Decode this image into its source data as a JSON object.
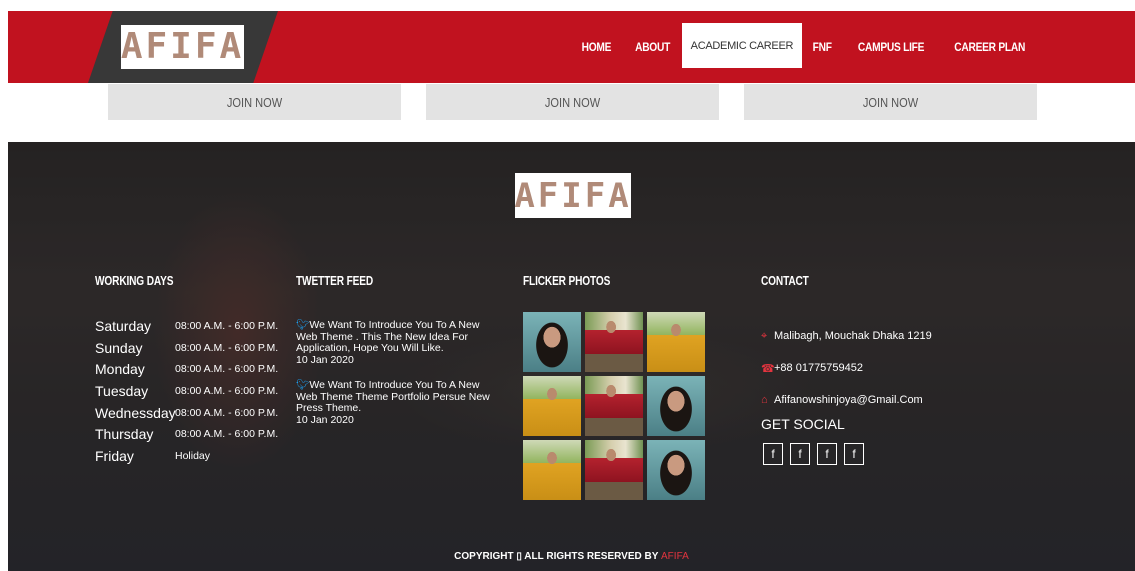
{
  "header": {
    "logo": "AFIFA",
    "nav": [
      {
        "label": "HOME",
        "active": false
      },
      {
        "label": "ABOUT",
        "active": false
      },
      {
        "label": "ACADEMIC CAREER",
        "active": true
      },
      {
        "label": "FNF",
        "active": false
      },
      {
        "label": "CAMPUS LIFE",
        "active": false
      },
      {
        "label": "CAREER PLAN",
        "active": false
      }
    ],
    "colors": {
      "brand_red": "#c1121f",
      "dark": "#383838",
      "logo_text": "#b08a78"
    }
  },
  "join_buttons": [
    "JOIN NOW",
    "JOIN NOW",
    "JOIN NOW"
  ],
  "footer": {
    "logo": "AFIFA",
    "working_days": {
      "title": "WORKING DAYS",
      "rows": [
        {
          "day": "Saturday",
          "time": "08:00 A.M. - 6:00 P.M."
        },
        {
          "day": "Sunday",
          "time": "08:00 A.M. - 6:00 P.M."
        },
        {
          "day": "Monday",
          "time": "08:00 A.M. - 6:00 P.M."
        },
        {
          "day": "Tuesday",
          "time": "08:00 A.M. - 6:00 P.M."
        },
        {
          "day": "Wednessday",
          "time": "08:00 A.M. - 6:00 P.M."
        },
        {
          "day": "Thursday",
          "time": "08:00 A.M. - 6:00 P.M."
        },
        {
          "day": "Friday",
          "time": "Holiday"
        }
      ]
    },
    "twitter": {
      "title": "TWETTER FEED",
      "tweets": [
        {
          "text": "We Want To Introduce You To A New Web Theme . This The New Idea For Application, Hope You Will Like.",
          "date": "10 Jan 2020"
        },
        {
          "text": "We Want To Introduce You To A New Web Theme Theme Portfolio Persue New Press Theme.",
          "date": "10 Jan 2020"
        }
      ]
    },
    "flicker": {
      "title": "FLICKER PHOTOS",
      "photos": [
        "portrait",
        "red-saree",
        "yellow-field",
        "yellow-field",
        "red-saree",
        "portrait",
        "yellow-field",
        "red-saree",
        "portrait"
      ]
    },
    "contact": {
      "title": "CONTACT",
      "address": "Malibagh, Mouchak Dhaka 1219",
      "phone": "+88 01775759452",
      "email": "Afifanowshinjoya@Gmail.Com",
      "social_title": "GET SOCIAL",
      "social_buttons": [
        "f",
        "f",
        "f",
        "f"
      ]
    },
    "copyright": {
      "text": "COPYRIGHT ▯ ALL RIGHTS RESERVED BY",
      "brand": "AFIFA"
    }
  }
}
